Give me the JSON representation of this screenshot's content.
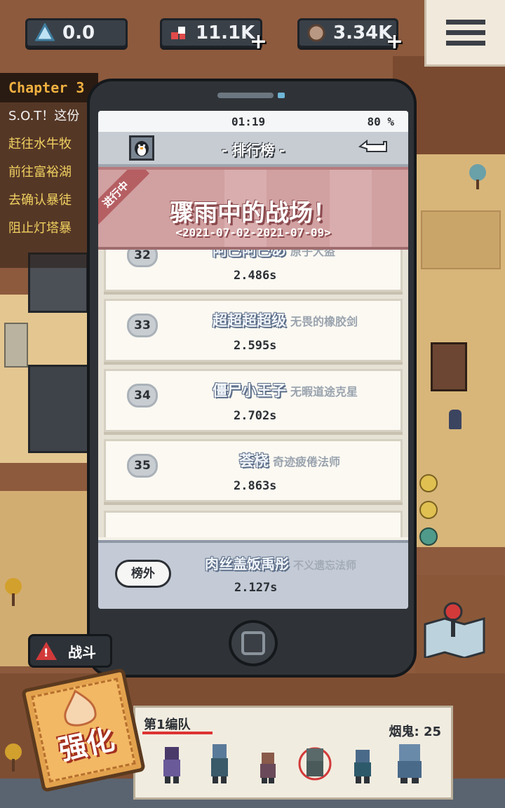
{
  "resources": [
    {
      "icon": "crystal-icon",
      "value": "0.0",
      "has_plus": false
    },
    {
      "icon": "gem-icon",
      "value": "11.1K",
      "has_plus": true
    },
    {
      "icon": "ore-icon",
      "value": "3.34K",
      "has_plus": true
    }
  ],
  "quest_panel": {
    "chapter": "Chapter 3",
    "lines": [
      "S.O.T！这份",
      "赶往水牛牧",
      "前往富裕湖",
      "去确认暴徒",
      "阻止灯塔暴"
    ]
  },
  "phone": {
    "status": {
      "time": "01:19",
      "battery": "80 %"
    },
    "nav": {
      "title": "- 排行榜 -",
      "back_icon": "back-arrow-icon"
    },
    "event": {
      "ribbon": "进行中",
      "name": "骤雨中的战场！",
      "date_range": "<2021-07-02-2021-07-09>"
    },
    "rows": [
      {
        "rank": "32",
        "name": "阿巴阿巴あ",
        "title": "原子大盗",
        "time": "2.486s"
      },
      {
        "rank": "33",
        "name": "超超超超级",
        "title": "无畏的橡胶剑",
        "time": "2.595s"
      },
      {
        "rank": "34",
        "name": "僵尸小王子",
        "title": "无暇道途克星",
        "time": "2.702s"
      },
      {
        "rank": "35",
        "name": "荟桡",
        "title": "奇迹疲倦法师",
        "time": "2.863s"
      }
    ],
    "my_entry": {
      "badge": "榜外",
      "name": "肉丝盖饭禹彤",
      "title": "不义遗忘法师",
      "time": "2.127s"
    }
  },
  "battle_button": {
    "label": "战斗"
  },
  "team": {
    "name": "第1编队",
    "cost_label": "烟鬼: 25"
  },
  "upgrade_button": {
    "label": "强化"
  },
  "colors": {
    "event_bg": "#d1a0a0",
    "nav_bg": "#c7ccd3",
    "phone_body": "#2f3338",
    "accent_red": "#d23a3a"
  }
}
